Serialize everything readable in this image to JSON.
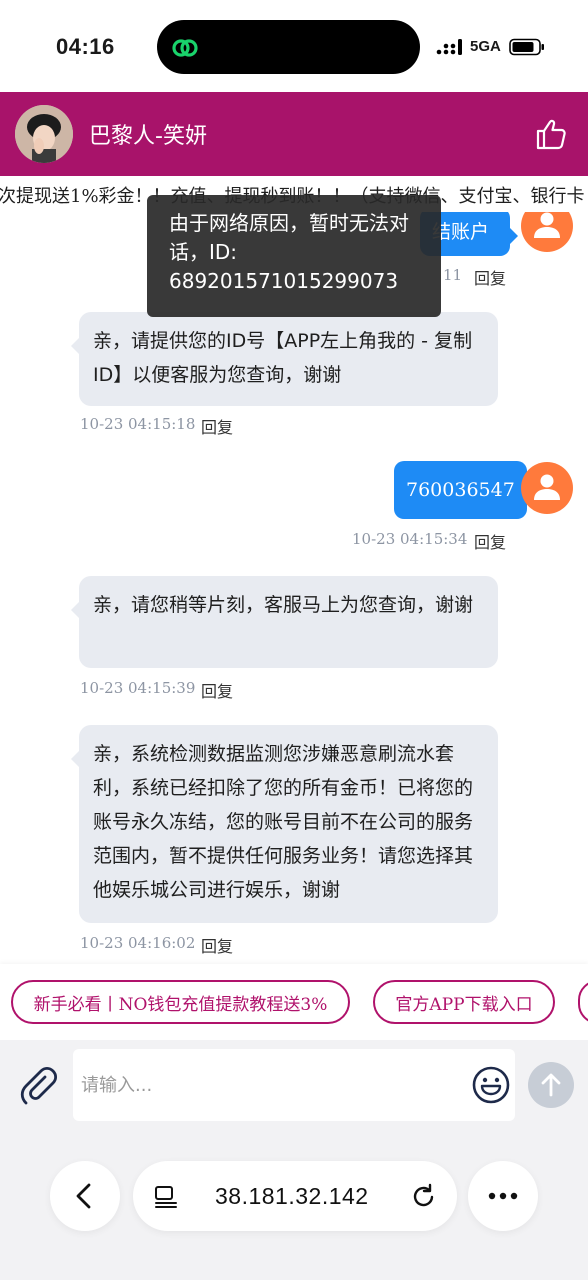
{
  "status_bar": {
    "time": "04:16",
    "network": "5GA"
  },
  "header": {
    "title": "巴黎人-笑妍"
  },
  "marquee": {
    "text": "次提现送1%彩金！！充值、提现秒到账！！（支持微信、支付宝、银行卡"
  },
  "toast": {
    "text": "由于网络原因，暂时无法对话，ID: 689201571015299073"
  },
  "messages": [
    {
      "side": "out",
      "text": "结账户",
      "time_fragment": "11",
      "reply": "回复"
    },
    {
      "side": "in",
      "text": "亲，请提供您的ID号【APP左上角我的 - 复制ID】以便客服为您查询，谢谢",
      "time": "10-23 04:15:18",
      "reply": "回复"
    },
    {
      "side": "out",
      "text": "760036547",
      "time": "10-23 04:15:34",
      "reply": "回复"
    },
    {
      "side": "in",
      "text": "亲，请您稍等片刻，客服马上为您查询，谢谢",
      "time": "10-23 04:15:39",
      "reply": "回复"
    },
    {
      "side": "in",
      "text": "亲，系统检测数据监测您涉嫌恶意刷流水套利，系统已经扣除了您的所有金币！已将您的账号永久冻结，您的账号目前不在公司的服务范围内，暂不提供任何服务业务！请您选择其他娱乐城公司进行娱乐，谢谢",
      "time": "10-23 04:16:02",
      "reply": "回复"
    }
  ],
  "quick_chips": [
    {
      "label": "新手必看丨NO钱包充值提款教程送3%"
    },
    {
      "label": "官方APP下载入口"
    }
  ],
  "input": {
    "placeholder": "请输入..."
  },
  "browser": {
    "url": "38.181.32.142"
  },
  "colors": {
    "header": "#a8136a",
    "out_bubble": "#1e8bf5",
    "in_bubble": "#e8ebf1",
    "user_avatar": "#ff7a3c",
    "chip": "#b0126b"
  }
}
